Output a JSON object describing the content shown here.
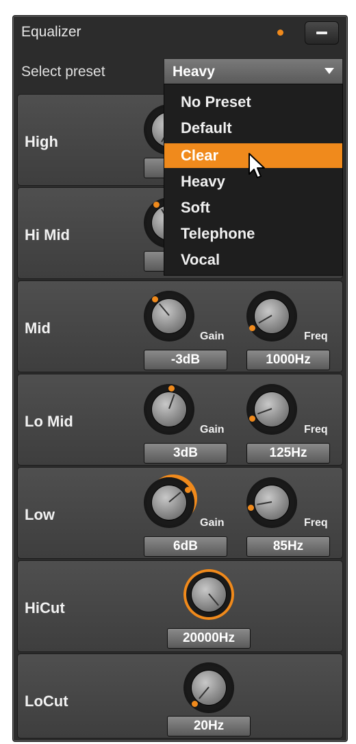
{
  "panel": {
    "title": "Equalizer",
    "accent": "#f08a1c"
  },
  "preset": {
    "label": "Select preset",
    "selected": "Heavy",
    "options": [
      "No Preset",
      "Default",
      "Clear",
      "Heavy",
      "Soft",
      "Telephone",
      "Vocal"
    ],
    "highlighted": "Clear"
  },
  "bands": [
    {
      "name": "High"
    },
    {
      "name": "Hi Mid"
    },
    {
      "name": "Mid",
      "gain_label": "Gain",
      "gain": "-3dB",
      "freq_label": "Freq",
      "freq": "1000Hz"
    },
    {
      "name": "Lo Mid",
      "gain_label": "Gain",
      "gain": "3dB",
      "freq_label": "Freq",
      "freq": "125Hz"
    },
    {
      "name": "Low",
      "gain_label": "Gain",
      "gain": "6dB",
      "freq_label": "Freq",
      "freq": "85Hz"
    },
    {
      "name": "HiCut",
      "freq": "20000Hz"
    },
    {
      "name": "LoCut",
      "freq": "20Hz"
    }
  ],
  "icons": {
    "minimize": "minimize-icon",
    "dropdown": "chevron-down-icon",
    "cursor": "mouse-pointer-icon"
  }
}
